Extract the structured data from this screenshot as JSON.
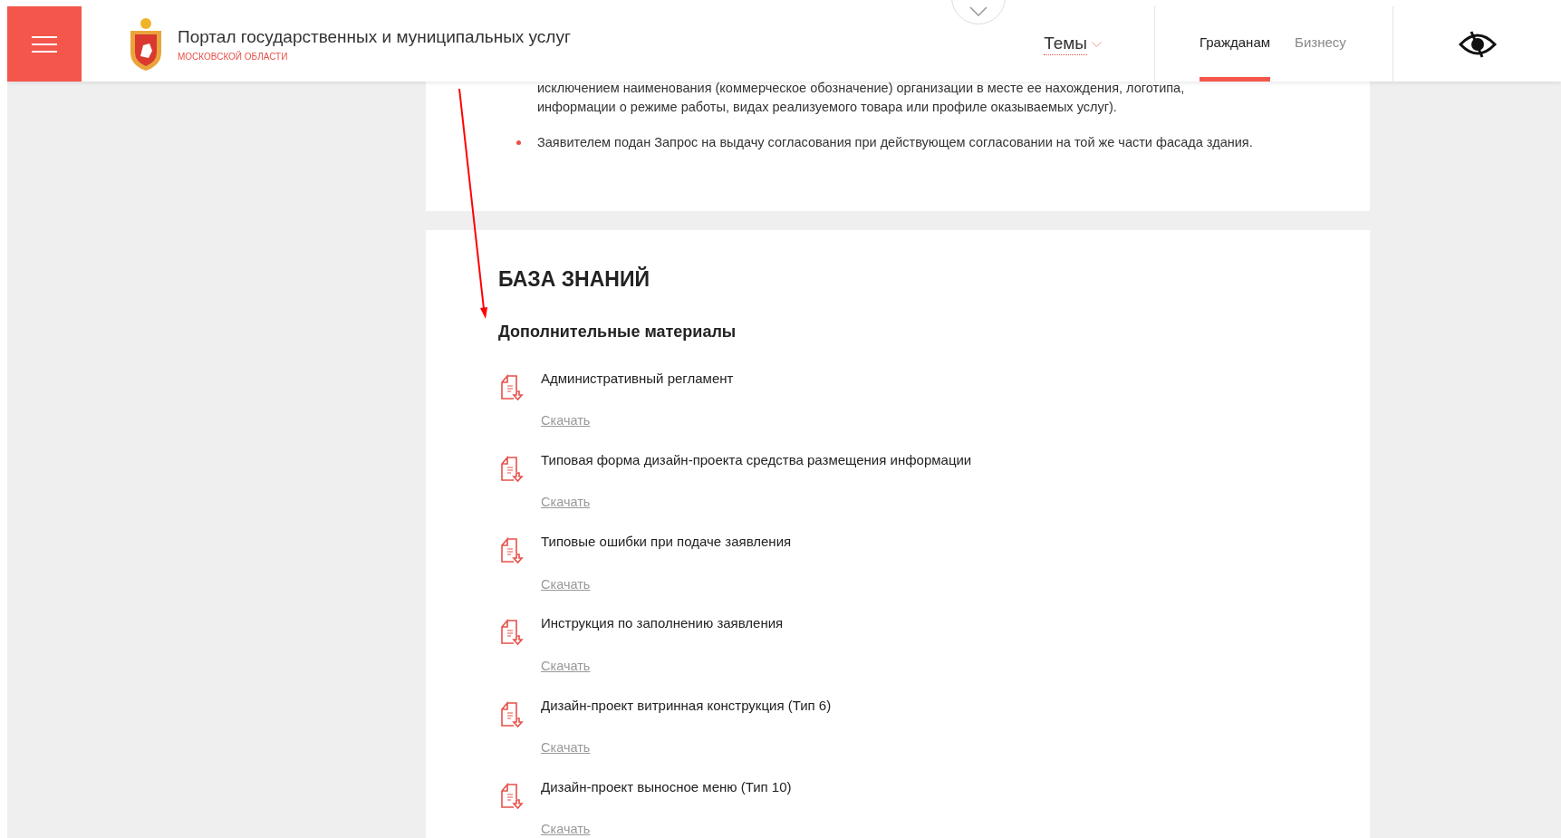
{
  "header": {
    "title": "Портал государственных и муниципальных услуг",
    "subtitle": "МОСКОВСКОЙ ОБЛАСТИ",
    "topics": "Темы",
    "tabs": [
      {
        "label": "Гражданам",
        "selected": true
      },
      {
        "label": "Бизнесу",
        "selected": false
      }
    ]
  },
  "conditions": [
    {
      "text": "исключением наименования (коммерческое обозначение) организации в месте ее нахождения, логотипа, информации о режиме работы, видах реализуемого товара или профиле оказываемых услуг).",
      "kind": "continuation"
    },
    {
      "text": "Заявителем подан Запрос на выдачу согласования при действующем согласовании на той же части фасада здания.",
      "kind": "bullet"
    }
  ],
  "knowledge_base": {
    "title": "БАЗА ЗНАНИЙ",
    "subtitle": "Дополнительные материалы",
    "documents": [
      {
        "title": "Административный регламент",
        "link": "Скачать"
      },
      {
        "title": "Типовая форма дизайн-проекта средства размещения информации",
        "link": "Скачать"
      },
      {
        "title": "Типовые ошибки при подаче заявления",
        "link": "Скачать"
      },
      {
        "title": "Инструкция по заполнению заявления",
        "link": "Скачать"
      },
      {
        "title": "Дизайн-проект витринная конструкция (Тип 6)",
        "link": "Скачать"
      },
      {
        "title": "Дизайн-проект выносное меню (Тип 10)",
        "link": "Скачать"
      }
    ]
  }
}
